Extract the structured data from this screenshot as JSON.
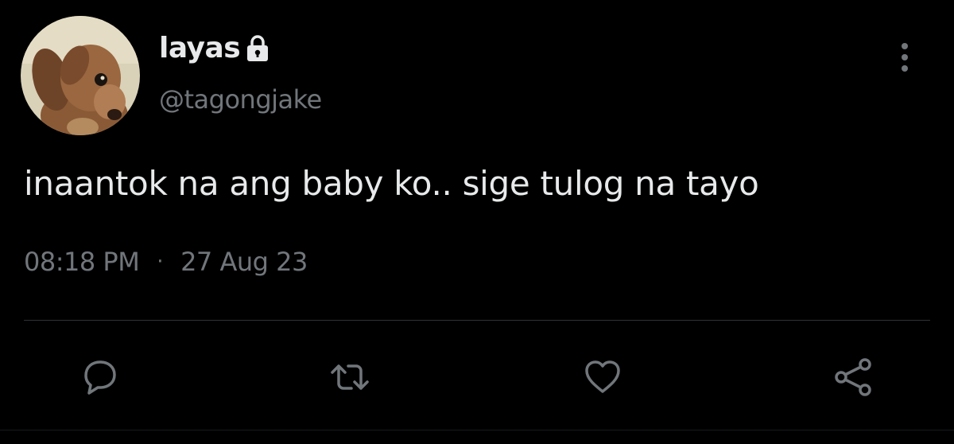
{
  "author": {
    "display_name": "layas",
    "handle": "@tagongjake",
    "protected_icon": "lock-icon",
    "avatar_icon": "dog-avatar"
  },
  "tweet": {
    "text": "inaantok na ang baby ko.. sige tulog na tayo",
    "time": "08:18 PM",
    "separator": "·",
    "date": "27 Aug 23"
  },
  "actions": {
    "reply_icon": "reply-icon",
    "retweet_icon": "retweet-icon",
    "like_icon": "heart-icon",
    "share_icon": "share-icon",
    "more_icon": "more-vertical-icon"
  },
  "colors": {
    "background": "#000000",
    "primary_text": "#e7e9ea",
    "secondary_text": "#71767b",
    "divider": "#2f3336"
  }
}
